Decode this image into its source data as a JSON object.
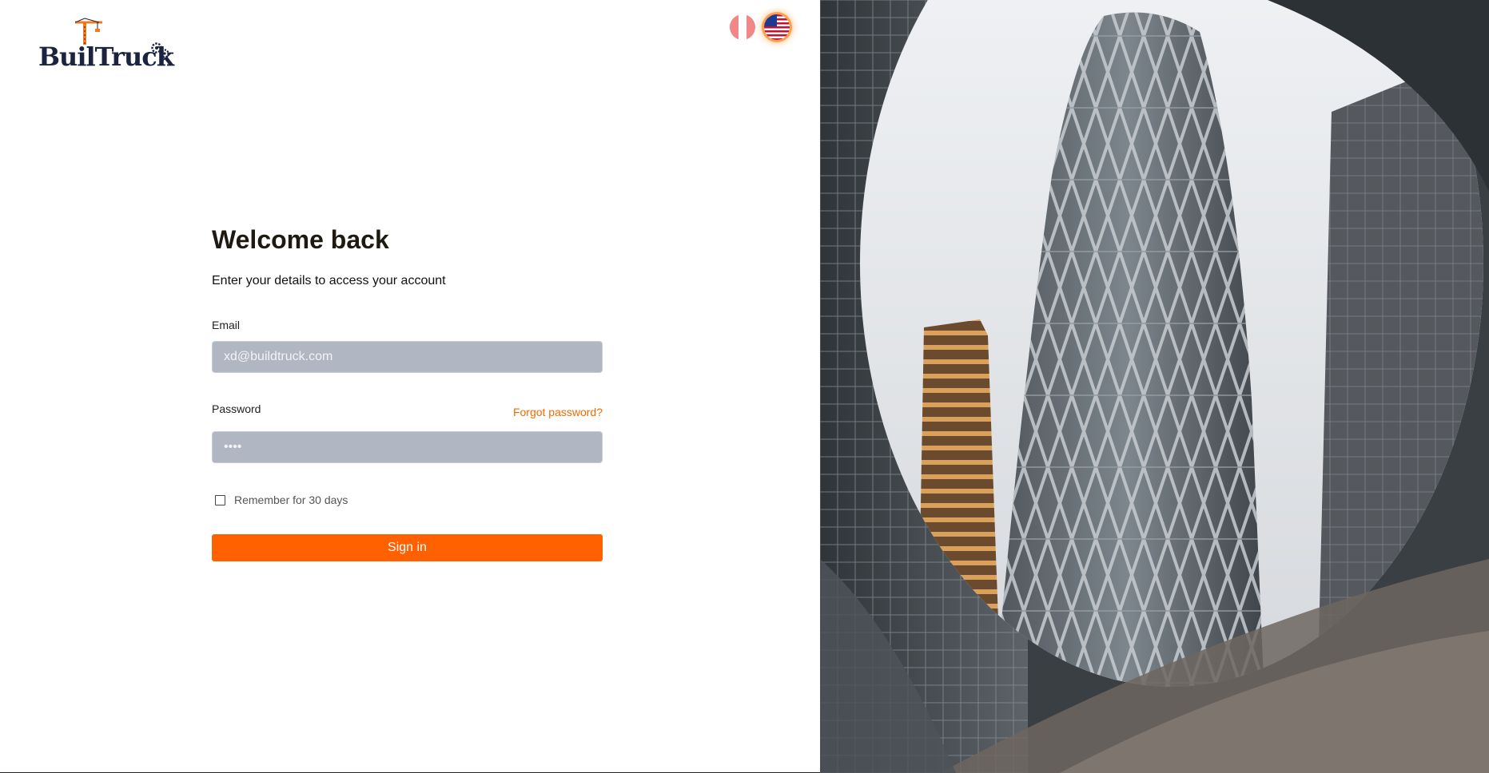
{
  "brand": {
    "logo_text": "BuilTruck",
    "accent_color": "#ff6000",
    "text_color": "#1c2340"
  },
  "language_switcher": {
    "options": [
      {
        "label": "Español (Perú)",
        "icon": "peru-flag-icon",
        "selected": false
      },
      {
        "label": "English (US)",
        "icon": "us-flag-icon",
        "selected": true
      }
    ]
  },
  "login": {
    "title": "Welcome back",
    "subtitle": "Enter your details to access your account",
    "email_label": "Email",
    "email_value": "xd@buildtruck.com",
    "password_label": "Password",
    "password_value": "••••",
    "forgot_password": "Forgot password?",
    "remember_label": "Remember for 30 days",
    "remember_checked": false,
    "submit_label": "Sign in"
  },
  "hero_image": {
    "description_icon": "skyscraper-photo"
  }
}
